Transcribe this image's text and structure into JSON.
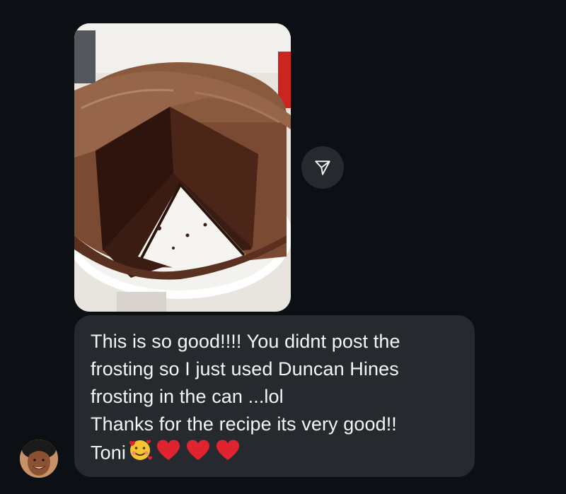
{
  "message": {
    "lines": [
      "This is so good!!!! You didnt post the",
      "frosting so I just used Duncan Hines",
      "frosting in the can ...lol",
      "Thanks for the recipe its very good!!",
      "Toni"
    ],
    "emojis": [
      "smiling-face-with-hearts",
      "red-heart",
      "red-heart",
      "red-heart"
    ]
  },
  "photo": {
    "subject": "chocolate-layer-cake-with-slice-removed"
  },
  "share_icon": "paper-plane-icon",
  "colors": {
    "background": "#0c1014",
    "bubble": "#262a2f",
    "text": "#f5f5f5",
    "heart": "#e0242f"
  }
}
